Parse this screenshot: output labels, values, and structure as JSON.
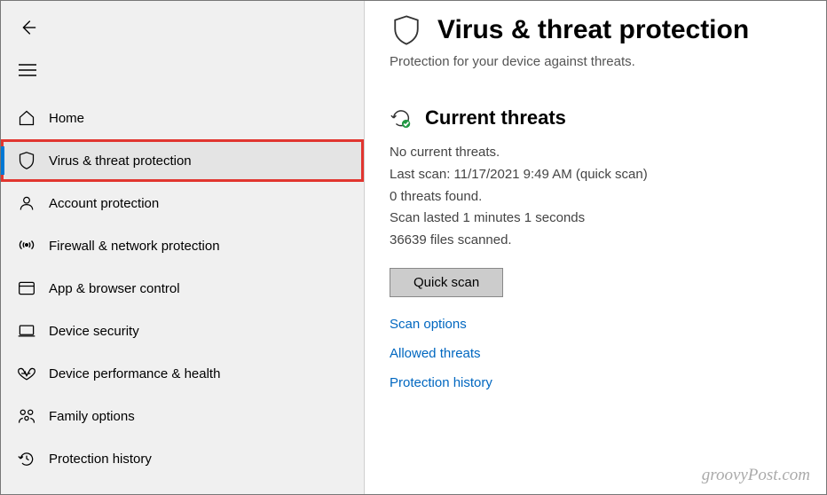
{
  "sidebar": {
    "items": [
      {
        "label": "Home"
      },
      {
        "label": "Virus & threat protection"
      },
      {
        "label": "Account protection"
      },
      {
        "label": "Firewall & network protection"
      },
      {
        "label": "App & browser control"
      },
      {
        "label": "Device security"
      },
      {
        "label": "Device performance & health"
      },
      {
        "label": "Family options"
      },
      {
        "label": "Protection history"
      }
    ]
  },
  "main": {
    "title": "Virus & threat protection",
    "subtitle": "Protection for your device against threats.",
    "section_title": "Current threats",
    "status": {
      "line1": "No current threats.",
      "line2": "Last scan: 11/17/2021 9:49 AM (quick scan)",
      "line3": "0 threats found.",
      "line4": "Scan lasted 1 minutes 1 seconds",
      "line5": "36639 files scanned."
    },
    "quick_scan_label": "Quick scan",
    "links": {
      "scan_options": "Scan options",
      "allowed_threats": "Allowed threats",
      "protection_history": "Protection history"
    }
  },
  "watermark": "groovyPost.com"
}
